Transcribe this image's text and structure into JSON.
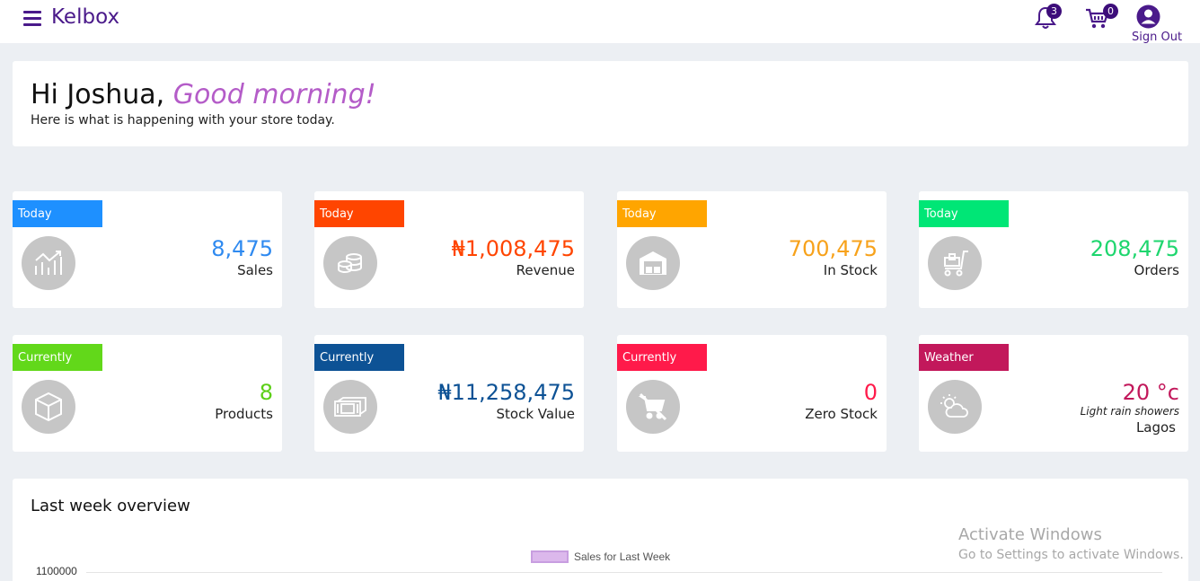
{
  "header": {
    "brand": "Kelbox",
    "notifications_count": "3",
    "cart_count": "0",
    "signout_label": "Sign Out"
  },
  "greeting": {
    "hi": "Hi Joshua,",
    "salutation": "Good morning!",
    "subtitle": "Here is what is happening with your store today."
  },
  "cards": [
    {
      "tag": "Today",
      "value": "8,475",
      "label": "Sales",
      "tag_color": "#1e90ff",
      "value_color": "#2f8af0",
      "icon": "sales-chart-icon"
    },
    {
      "tag": "Today",
      "value": "₦1,008,475",
      "label": "Revenue",
      "tag_color": "#ff4500",
      "value_color": "#ff4500",
      "icon": "coins-icon"
    },
    {
      "tag": "Today",
      "value": "700,475",
      "label": "In Stock",
      "tag_color": "#ffa500",
      "value_color": "#f7a21b",
      "icon": "warehouse-icon"
    },
    {
      "tag": "Today",
      "value": "208,475",
      "label": "Orders",
      "tag_color": "#00e676",
      "value_color": "#1ed66e",
      "icon": "cart-icon"
    },
    {
      "tag": "Currently",
      "value": "8",
      "label": "Products",
      "tag_color": "#62d81a",
      "value_color": "#5ccf17",
      "icon": "box-icon"
    },
    {
      "tag": "Currently",
      "value": "₦11,258,475",
      "label": "Stock Value",
      "tag_color": "#0d5295",
      "value_color": "#0d5295",
      "icon": "cash-icon"
    },
    {
      "tag": "Currently",
      "value": "0",
      "label": "Zero Stock",
      "tag_color": "#ff1a4a",
      "value_color": "#ff1a4a",
      "icon": "no-cart-icon"
    },
    {
      "tag": "Weather",
      "value": "20 °c",
      "description": "Light rain showers",
      "city": "Lagos",
      "tag_color": "#c2185b",
      "value_color": "#c2185b",
      "icon": "weather-cloud-sun-icon"
    }
  ],
  "overview": {
    "title": "Last week overview",
    "legend": "Sales for Last Week",
    "ytick_top": "1100000"
  },
  "watermark": {
    "line1": "Activate Windows",
    "line2": "Go to Settings to activate Windows."
  }
}
